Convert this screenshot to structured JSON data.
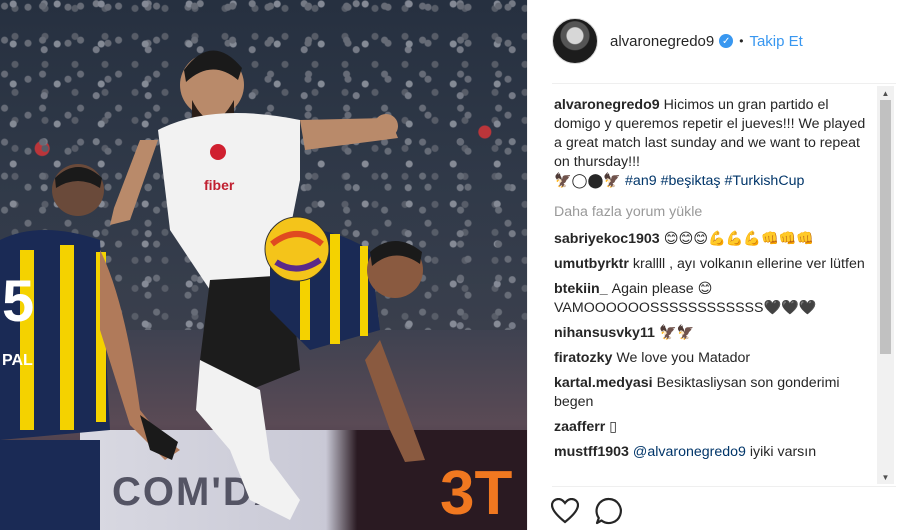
{
  "photo": {
    "board_text": "COM'DA",
    "board_number": "3T",
    "jersey_number": "5",
    "jersey_name": "PAL",
    "sponsor": "fiber",
    "colors": {
      "bjk_white": "#f2f2f2",
      "fb_navy": "#1a2a55",
      "fb_yellow": "#f4d200"
    }
  },
  "header": {
    "username": "alvaronegredo9",
    "verified_glyph": "✓",
    "separator": "•",
    "follow_label": "Takip Et"
  },
  "caption": {
    "username": "alvaronegredo9",
    "text": "Hicimos un gran partido el domigo y queremos repetir el jueves!!! We played a great match last sunday and we want to repeat on thursday!!!",
    "emoji_line": "🦅◯⬤🦅",
    "hashtags": [
      "#an9",
      "#beşiktaş",
      "#TurkishCup"
    ]
  },
  "load_more_label": "Daha fazla yorum yükle",
  "comments": [
    {
      "user": "sabriyekoc1903",
      "text": "😊😊😊💪💪💪👊👊👊"
    },
    {
      "user": "umutbyrktr",
      "text": "krallll , ayı volkanın ellerine ver lütfen"
    },
    {
      "user": "btekiin_",
      "text": "Again please 😊 VAMOOOOOOSSSSSSSSSSSS🖤🖤🖤"
    },
    {
      "user": "nihansusvky11",
      "text": "🦅🦅"
    },
    {
      "user": "firatozky",
      "text": "We love you Matador"
    },
    {
      "user": "kartal.medyasi",
      "text": "Besiktasliysan son gonderimi begen"
    },
    {
      "user": "zaafferr",
      "text": "▯"
    },
    {
      "user": "mustff1903",
      "mention": "@alvaronegredo9",
      "text": "iyiki varsın"
    }
  ],
  "actions": {
    "like_icon": "heart-icon",
    "comment_icon": "comment-icon"
  },
  "accent": "#3897f0"
}
